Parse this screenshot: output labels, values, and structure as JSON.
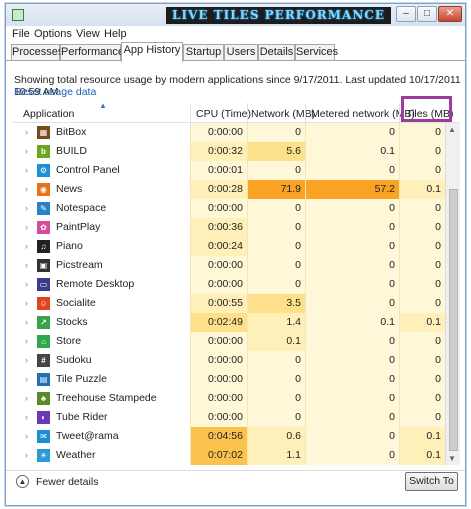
{
  "window": {
    "title": "LIVE TILES PERFORMANCE",
    "controls": {
      "minimize": "–",
      "maximize": "□",
      "close": "✕"
    }
  },
  "menu": [
    "File",
    "Options",
    "View",
    "Help"
  ],
  "tabs": [
    {
      "label": "Processes",
      "active": false
    },
    {
      "label": "Performance",
      "active": false
    },
    {
      "label": "App History",
      "active": true
    },
    {
      "label": "Startup",
      "active": false
    },
    {
      "label": "Users",
      "active": false
    },
    {
      "label": "Details",
      "active": false
    },
    {
      "label": "Services",
      "active": false
    }
  ],
  "summary": "Showing total resource usage by modern applications since 9/17/2011. Last updated 10/17/2011 10:59 AM",
  "reset_label": "Reset usage data",
  "columns": {
    "application": "Application",
    "cpu": "CPU (Time)",
    "network": "Network (MB)",
    "metered": "Metered network (MB)",
    "tiles": "Tiles (MB)"
  },
  "rows": [
    {
      "name": "BitBox",
      "icon": "bitbox-icon",
      "icon_color": "#7a4a1a",
      "icon_glyph": "▦",
      "cpu": "0:00:00",
      "network": "0",
      "metered": "0",
      "tiles": "0",
      "cpu_heat": 0,
      "net_heat": 0,
      "met_heat": 0,
      "til_heat": 0
    },
    {
      "name": "BUILD",
      "icon": "build-icon",
      "icon_color": "#6aa621",
      "icon_glyph": "b",
      "cpu": "0:00:32",
      "network": "5.6",
      "metered": "0.1",
      "tiles": "0",
      "cpu_heat": 1,
      "net_heat": 2,
      "met_heat": 0,
      "til_heat": 0
    },
    {
      "name": "Control Panel",
      "icon": "control-panel-icon",
      "icon_color": "#1e8fd6",
      "icon_glyph": "⚙",
      "cpu": "0:00:01",
      "network": "0",
      "metered": "0",
      "tiles": "0",
      "cpu_heat": 0,
      "net_heat": 0,
      "met_heat": 0,
      "til_heat": 0
    },
    {
      "name": "News",
      "icon": "news-icon",
      "icon_color": "#e8711a",
      "icon_glyph": "◉",
      "cpu": "0:00:28",
      "network": "71.9",
      "metered": "57.2",
      "tiles": "0.1",
      "cpu_heat": 1,
      "net_heat": 4,
      "met_heat": 4,
      "til_heat": 1
    },
    {
      "name": "Notespace",
      "icon": "notespace-icon",
      "icon_color": "#2a82c9",
      "icon_glyph": "✎",
      "cpu": "0:00:00",
      "network": "0",
      "metered": "0",
      "tiles": "0",
      "cpu_heat": 0,
      "net_heat": 0,
      "met_heat": 0,
      "til_heat": 0
    },
    {
      "name": "PaintPlay",
      "icon": "paintplay-icon",
      "icon_color": "#d94a9a",
      "icon_glyph": "✿",
      "cpu": "0:00:36",
      "network": "0",
      "metered": "0",
      "tiles": "0",
      "cpu_heat": 1,
      "net_heat": 0,
      "met_heat": 0,
      "til_heat": 0
    },
    {
      "name": "Piano",
      "icon": "piano-icon",
      "icon_color": "#222222",
      "icon_glyph": "♫",
      "cpu": "0:00:24",
      "network": "0",
      "metered": "0",
      "tiles": "0",
      "cpu_heat": 1,
      "net_heat": 0,
      "met_heat": 0,
      "til_heat": 0
    },
    {
      "name": "Picstream",
      "icon": "picstream-icon",
      "icon_color": "#333333",
      "icon_glyph": "▣",
      "cpu": "0:00:00",
      "network": "0",
      "metered": "0",
      "tiles": "0",
      "cpu_heat": 0,
      "net_heat": 0,
      "met_heat": 0,
      "til_heat": 0
    },
    {
      "name": "Remote Desktop",
      "icon": "remote-desktop-icon",
      "icon_color": "#3b3b8c",
      "icon_glyph": "▭",
      "cpu": "0:00:00",
      "network": "0",
      "metered": "0",
      "tiles": "0",
      "cpu_heat": 0,
      "net_heat": 0,
      "met_heat": 0,
      "til_heat": 0
    },
    {
      "name": "Socialite",
      "icon": "socialite-icon",
      "icon_color": "#e0431d",
      "icon_glyph": "☺",
      "cpu": "0:00:55",
      "network": "3.5",
      "metered": "0",
      "tiles": "0",
      "cpu_heat": 1,
      "net_heat": 2,
      "met_heat": 0,
      "til_heat": 0
    },
    {
      "name": "Stocks",
      "icon": "stocks-icon",
      "icon_color": "#3aa34a",
      "icon_glyph": "↗",
      "cpu": "0:02:49",
      "network": "1.4",
      "metered": "0.1",
      "tiles": "0.1",
      "cpu_heat": 2,
      "net_heat": 1,
      "met_heat": 0,
      "til_heat": 1
    },
    {
      "name": "Store",
      "icon": "store-icon",
      "icon_color": "#2fa84a",
      "icon_glyph": "⌂",
      "cpu": "0:00:00",
      "network": "0.1",
      "metered": "0",
      "tiles": "0",
      "cpu_heat": 0,
      "net_heat": 1,
      "met_heat": 0,
      "til_heat": 0
    },
    {
      "name": "Sudoku",
      "icon": "sudoku-icon",
      "icon_color": "#444444",
      "icon_glyph": "#",
      "cpu": "0:00:00",
      "network": "0",
      "metered": "0",
      "tiles": "0",
      "cpu_heat": 0,
      "net_heat": 0,
      "met_heat": 0,
      "til_heat": 0
    },
    {
      "name": "Tile Puzzle",
      "icon": "tile-puzzle-icon",
      "icon_color": "#1e6fb4",
      "icon_glyph": "▤",
      "cpu": "0:00:00",
      "network": "0",
      "metered": "0",
      "tiles": "0",
      "cpu_heat": 0,
      "net_heat": 0,
      "met_heat": 0,
      "til_heat": 0
    },
    {
      "name": "Treehouse Stampede",
      "icon": "treehouse-stampede-icon",
      "icon_color": "#5c8a2a",
      "icon_glyph": "♣",
      "cpu": "0:00:00",
      "network": "0",
      "metered": "0",
      "tiles": "0",
      "cpu_heat": 0,
      "net_heat": 0,
      "met_heat": 0,
      "til_heat": 0
    },
    {
      "name": "Tube Rider",
      "icon": "tube-rider-icon",
      "icon_color": "#6a3ab2",
      "icon_glyph": "◐",
      "cpu": "0:00:00",
      "network": "0",
      "metered": "0",
      "tiles": "0",
      "cpu_heat": 0,
      "net_heat": 0,
      "met_heat": 0,
      "til_heat": 0
    },
    {
      "name": "Tweet@rama",
      "icon": "tweetrama-icon",
      "icon_color": "#1a8fd6",
      "icon_glyph": "✉",
      "cpu": "0:04:56",
      "network": "0.6",
      "metered": "0",
      "tiles": "0.1",
      "cpu_heat": 3,
      "net_heat": 1,
      "met_heat": 0,
      "til_heat": 1
    },
    {
      "name": "Weather",
      "icon": "weather-icon",
      "icon_color": "#2a9ad6",
      "icon_glyph": "☀",
      "cpu": "0:07:02",
      "network": "1.1",
      "metered": "0",
      "tiles": "0.1",
      "cpu_heat": 3,
      "net_heat": 1,
      "met_heat": 0,
      "til_heat": 1
    }
  ],
  "heat_colors": [
    "#fff8d8",
    "#fef0b8",
    "#fde08a",
    "#fcc24e",
    "#f9a224"
  ],
  "footer": {
    "fewer_details": "Fewer details",
    "switch_to": "Switch To"
  }
}
